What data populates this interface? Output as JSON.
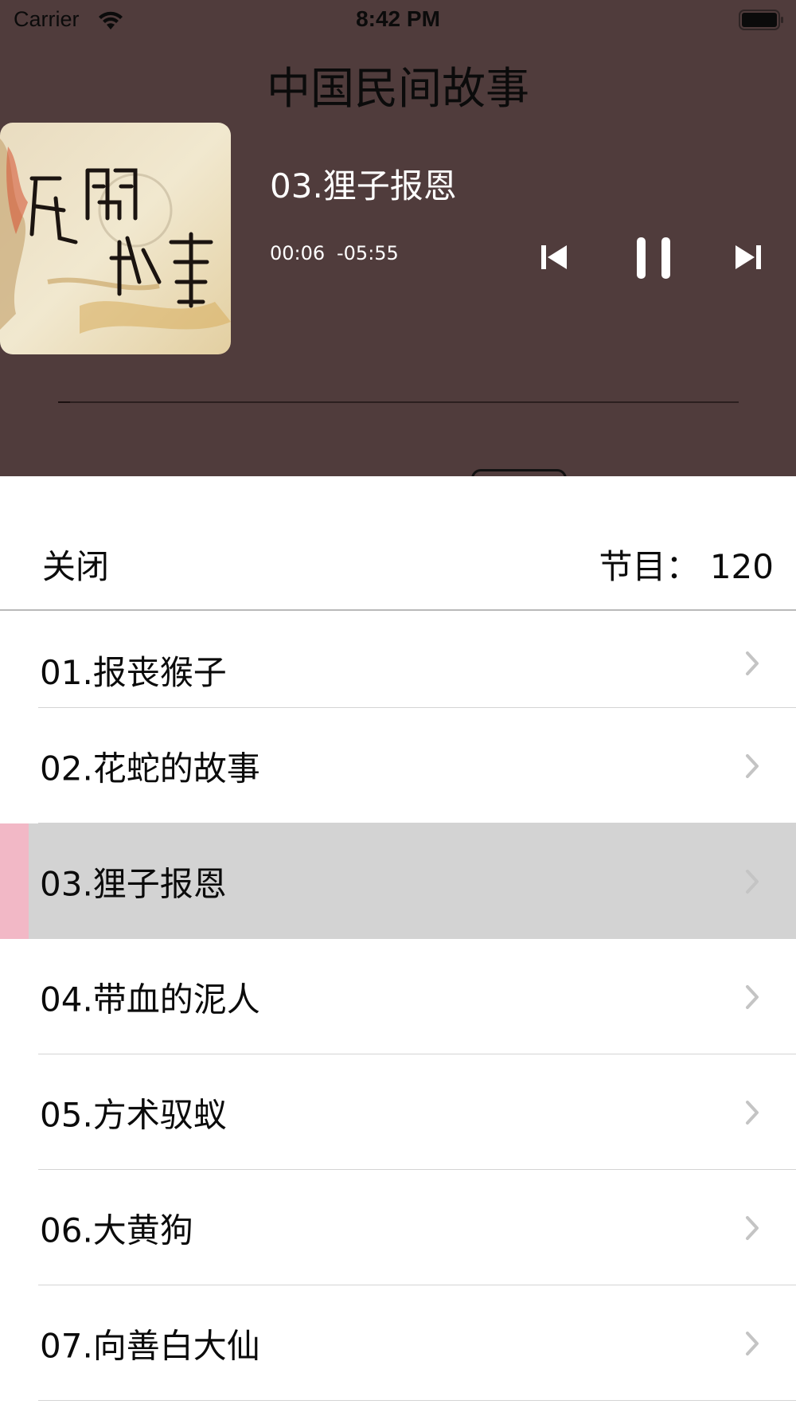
{
  "status_bar": {
    "carrier": "Carrier",
    "time": "8:42 PM",
    "wifi_icon": "wifi-icon",
    "battery_icon": "battery-icon"
  },
  "player": {
    "album_title": "中国民间故事",
    "cover_icon": "album-cover-image",
    "track_title": "03.狸子报恩",
    "time_elapsed": "00:06",
    "time_remaining": "-05:55",
    "progress": 0.017,
    "controls": {
      "prev_icon": "skip-back-icon",
      "pause_icon": "pause-icon",
      "next_icon": "skip-forward-icon"
    },
    "colors": {
      "background": "#503c3c",
      "text": "#ffffff"
    }
  },
  "sheet": {
    "close_label": "关闭",
    "count_label": "节目： 120"
  },
  "episodes": [
    {
      "label": "01.报丧猴子",
      "selected": false
    },
    {
      "label": "02.花蛇的故事",
      "selected": false
    },
    {
      "label": "03.狸子报恩",
      "selected": true
    },
    {
      "label": "04.带血的泥人",
      "selected": false
    },
    {
      "label": "05.方术驭蚁",
      "selected": false
    },
    {
      "label": "06.大黄狗",
      "selected": false
    },
    {
      "label": "07.向善白大仙",
      "selected": false
    }
  ],
  "colors": {
    "selected_row": "#d3d3d3",
    "selected_indicator": "#f2b8c6"
  }
}
